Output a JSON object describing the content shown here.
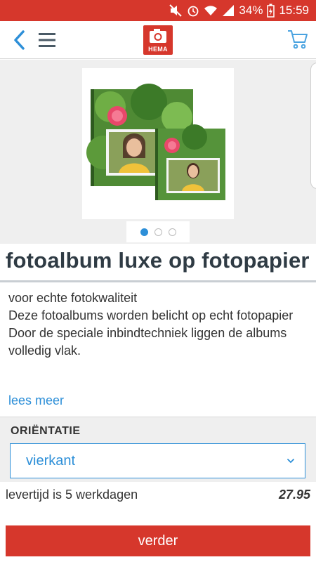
{
  "status_bar": {
    "battery": "34%",
    "time": "15:59"
  },
  "header": {
    "logo_text": "HEMA",
    "icons": {
      "back": "back-chevron-icon",
      "menu": "hamburger-menu-icon",
      "cart": "shopping-cart-icon"
    }
  },
  "carousel": {
    "slide_count": 3,
    "active_index": 0
  },
  "product": {
    "title": "fotoalbum luxe op fotopapier",
    "description": [
      "voor echte fotokwaliteit",
      "Deze fotoalbums worden belicht op echt fotopapier",
      "Door de speciale inbindtechniek liggen de albums volledig vlak."
    ],
    "more_link": "lees meer"
  },
  "options": {
    "label": "ORIËNTATIE",
    "selected": "vierkant"
  },
  "delivery": {
    "text": "levertijd is 5 werkdagen",
    "price": "27.95"
  },
  "cta": {
    "label": "verder"
  },
  "colors": {
    "brand_red": "#d6372c",
    "accent_blue": "#2d8fd8",
    "title_color": "#2f3b44"
  }
}
